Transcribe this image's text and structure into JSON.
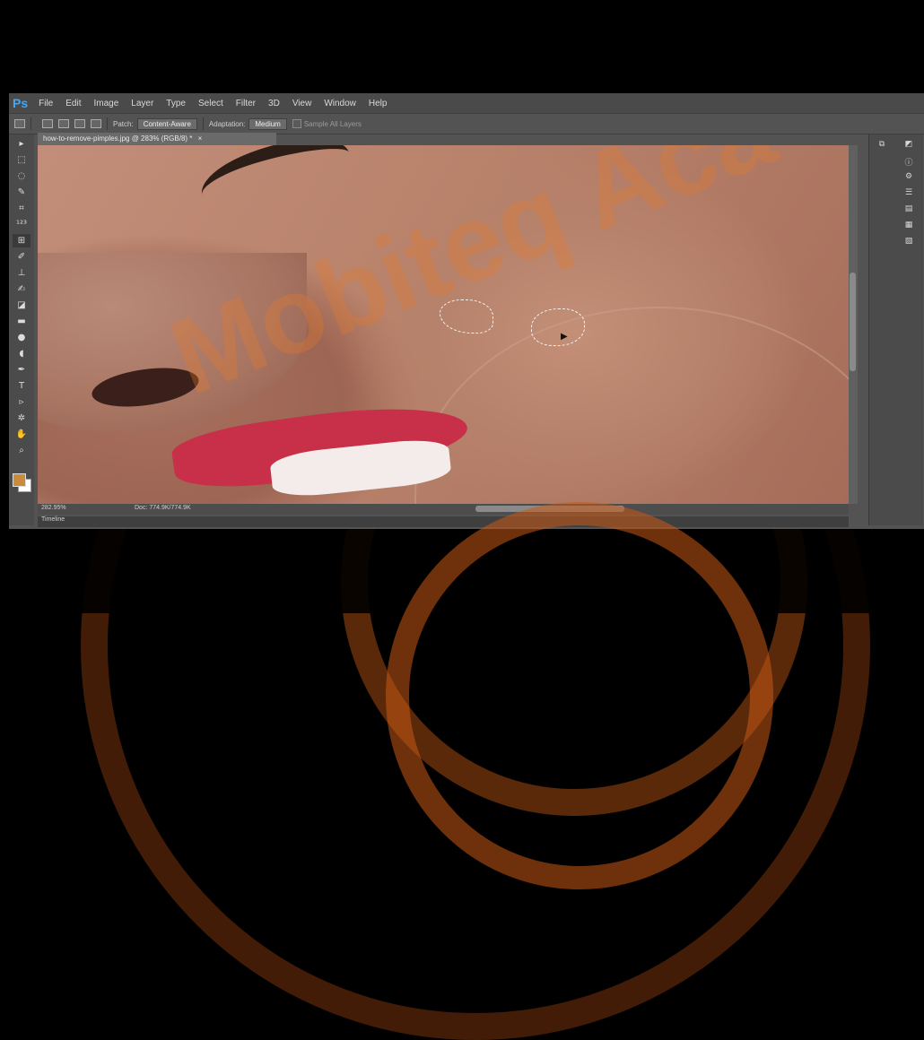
{
  "menu": {
    "logo": "Ps",
    "items": [
      "File",
      "Edit",
      "Image",
      "Layer",
      "Type",
      "Select",
      "Filter",
      "3D",
      "View",
      "Window",
      "Help"
    ]
  },
  "options": {
    "patch_label": "Patch:",
    "patch_mode": "Content-Aware",
    "adaptation_label": "Adaptation:",
    "adaptation_value": "Medium",
    "sample_all_layers": "Sample All Layers"
  },
  "document": {
    "tab_title": "how-to-remove-pimples.jpg @ 283% (RGB/8) *",
    "close_glyph": "×"
  },
  "status": {
    "zoom": "282.95%",
    "doc_info": "Doc: 774.9K/774.9K"
  },
  "timeline": {
    "label": "Timeline"
  },
  "watermark": {
    "text": "Mobiteq Aca"
  },
  "colors": {
    "foreground": "#c98b3c",
    "background": "#ffffff",
    "ps_blue": "#3ea8ff"
  },
  "icons": {
    "tools": [
      "move-tool-icon",
      "marquee-tool-icon",
      "lasso-tool-icon",
      "quick-select-tool-icon",
      "crop-tool-icon",
      "eyedropper-tool-icon",
      "patch-tool-icon",
      "brush-tool-icon",
      "clone-stamp-tool-icon",
      "history-brush-tool-icon",
      "eraser-tool-icon",
      "gradient-tool-icon",
      "blur-tool-icon",
      "dodge-tool-icon",
      "pen-tool-icon",
      "type-tool-icon",
      "path-select-tool-icon",
      "shape-tool-icon",
      "hand-tool-icon",
      "zoom-tool-icon"
    ]
  }
}
